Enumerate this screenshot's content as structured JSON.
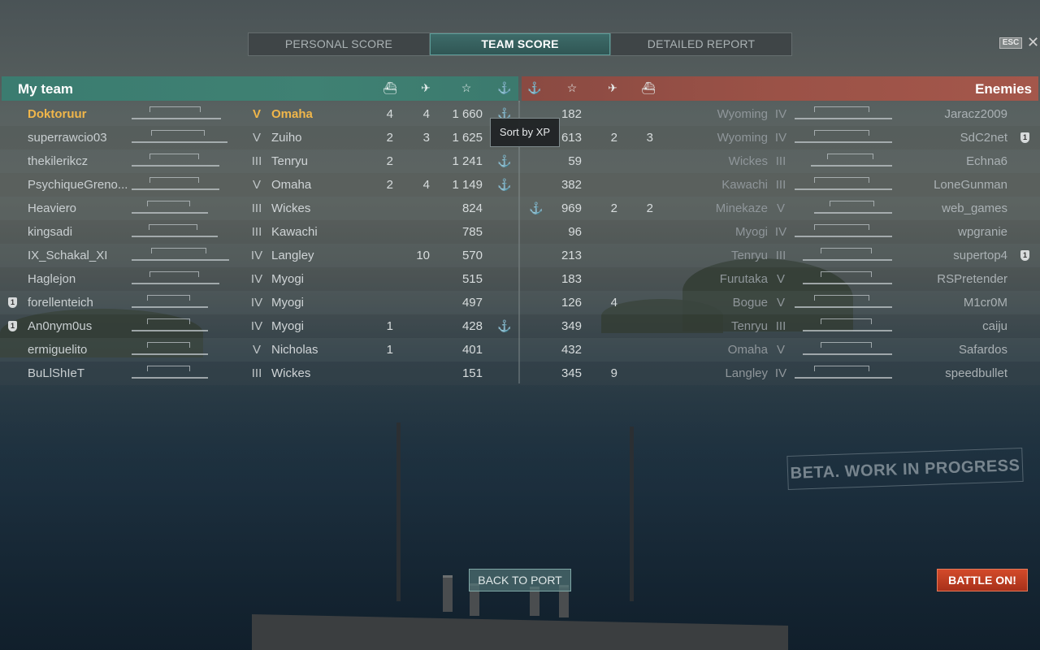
{
  "tabs": [
    {
      "label": "PERSONAL SCORE",
      "active": false
    },
    {
      "label": "TEAM SCORE",
      "active": true
    },
    {
      "label": "DETAILED REPORT",
      "active": false
    }
  ],
  "esc_label": "ESC",
  "close_label": "✕",
  "my_team": {
    "title": "My team",
    "columns": [
      "ships-destroyed-icon",
      "planes-destroyed-icon",
      "xp-star-icon",
      "anchor-icon"
    ],
    "rows": [
      {
        "player": "Doktoruur",
        "tier": "V",
        "ship": "Omaha",
        "kills": "4",
        "planes": "4",
        "xp": "1 660",
        "anchor": "⚓",
        "me": true,
        "badge": ""
      },
      {
        "player": "superrawcio03",
        "tier": "V",
        "ship": "Zuiho",
        "kills": "2",
        "planes": "3",
        "xp": "1 625",
        "anchor": "",
        "me": false,
        "badge": ""
      },
      {
        "player": "thekilerikcz",
        "tier": "III",
        "ship": "Tenryu",
        "kills": "2",
        "planes": "",
        "xp": "1 241",
        "anchor": "⚓",
        "me": false,
        "badge": ""
      },
      {
        "player": "PsychiqueGreno...",
        "tier": "V",
        "ship": "Omaha",
        "kills": "2",
        "planes": "4",
        "xp": "1 149",
        "anchor": "⚓",
        "me": false,
        "badge": ""
      },
      {
        "player": "Heaviero",
        "tier": "III",
        "ship": "Wickes",
        "kills": "",
        "planes": "",
        "xp": "824",
        "anchor": "",
        "me": false,
        "badge": ""
      },
      {
        "player": "kingsadi",
        "tier": "III",
        "ship": "Kawachi",
        "kills": "",
        "planes": "",
        "xp": "785",
        "anchor": "",
        "me": false,
        "badge": ""
      },
      {
        "player": "IX_Schakal_XI",
        "tier": "IV",
        "ship": "Langley",
        "kills": "",
        "planes": "10",
        "xp": "570",
        "anchor": "",
        "me": false,
        "badge": ""
      },
      {
        "player": "Haglejon",
        "tier": "IV",
        "ship": "Myogi",
        "kills": "",
        "planes": "",
        "xp": "515",
        "anchor": "",
        "me": false,
        "badge": ""
      },
      {
        "player": "forellenteich",
        "tier": "IV",
        "ship": "Myogi",
        "kills": "",
        "planes": "",
        "xp": "497",
        "anchor": "",
        "me": false,
        "badge": "1"
      },
      {
        "player": "An0nym0us",
        "tier": "IV",
        "ship": "Myogi",
        "kills": "1",
        "planes": "",
        "xp": "428",
        "anchor": "⚓",
        "me": false,
        "badge": "1"
      },
      {
        "player": "ermiguelito",
        "tier": "V",
        "ship": "Nicholas",
        "kills": "1",
        "planes": "",
        "xp": "401",
        "anchor": "",
        "me": false,
        "badge": ""
      },
      {
        "player": "BuLlShIeT",
        "tier": "III",
        "ship": "Wickes",
        "kills": "",
        "planes": "",
        "xp": "151",
        "anchor": "",
        "me": false,
        "badge": ""
      }
    ]
  },
  "enemies": {
    "title": "Enemies",
    "columns": [
      "anchor-icon",
      "xp-star-icon",
      "planes-destroyed-icon",
      "ships-destroyed-icon"
    ],
    "rows": [
      {
        "anchor": "",
        "xp": "182",
        "planes": "",
        "kills": "",
        "ship": "Wyoming",
        "tier": "IV",
        "player": "Jaracz2009",
        "badge": ""
      },
      {
        "anchor": "",
        "xp": "613",
        "planes": "2",
        "kills": "3",
        "ship": "Wyoming",
        "tier": "IV",
        "player": "SdC2net",
        "badge": "1"
      },
      {
        "anchor": "",
        "xp": "59",
        "planes": "",
        "kills": "",
        "ship": "Wickes",
        "tier": "III",
        "player": "Echna6",
        "badge": ""
      },
      {
        "anchor": "",
        "xp": "382",
        "planes": "",
        "kills": "",
        "ship": "Kawachi",
        "tier": "III",
        "player": "LoneGunman",
        "badge": ""
      },
      {
        "anchor": "⚓",
        "xp": "969",
        "planes": "2",
        "kills": "2",
        "ship": "Minekaze",
        "tier": "V",
        "player": "web_games",
        "badge": ""
      },
      {
        "anchor": "",
        "xp": "96",
        "planes": "",
        "kills": "",
        "ship": "Myogi",
        "tier": "IV",
        "player": "wpgranie",
        "badge": ""
      },
      {
        "anchor": "",
        "xp": "213",
        "planes": "",
        "kills": "",
        "ship": "Tenryu",
        "tier": "III",
        "player": "supertop4",
        "badge": "1"
      },
      {
        "anchor": "",
        "xp": "183",
        "planes": "",
        "kills": "",
        "ship": "Furutaka",
        "tier": "V",
        "player": "RSPretender",
        "badge": ""
      },
      {
        "anchor": "",
        "xp": "126",
        "planes": "4",
        "kills": "",
        "ship": "Bogue",
        "tier": "V",
        "player": "M1cr0M",
        "badge": ""
      },
      {
        "anchor": "",
        "xp": "349",
        "planes": "",
        "kills": "",
        "ship": "Tenryu",
        "tier": "III",
        "player": "caiju",
        "badge": ""
      },
      {
        "anchor": "",
        "xp": "432",
        "planes": "",
        "kills": "",
        "ship": "Omaha",
        "tier": "V",
        "player": "Safardos",
        "badge": ""
      },
      {
        "anchor": "",
        "xp": "345",
        "planes": "9",
        "kills": "",
        "ship": "Langley",
        "tier": "IV",
        "player": "speedbullet",
        "badge": ""
      }
    ]
  },
  "tooltip": "Sort by XP",
  "beta_text": "BETA. WORK IN PROGRESS",
  "back_to_port": "BACK TO PORT",
  "battle_on": "BATTLE ON!",
  "colors": {
    "accent_team": "#3f8173",
    "accent_enemy": "#9b5247",
    "highlight": "#f0b64a",
    "battle_button": "#c23f22"
  }
}
